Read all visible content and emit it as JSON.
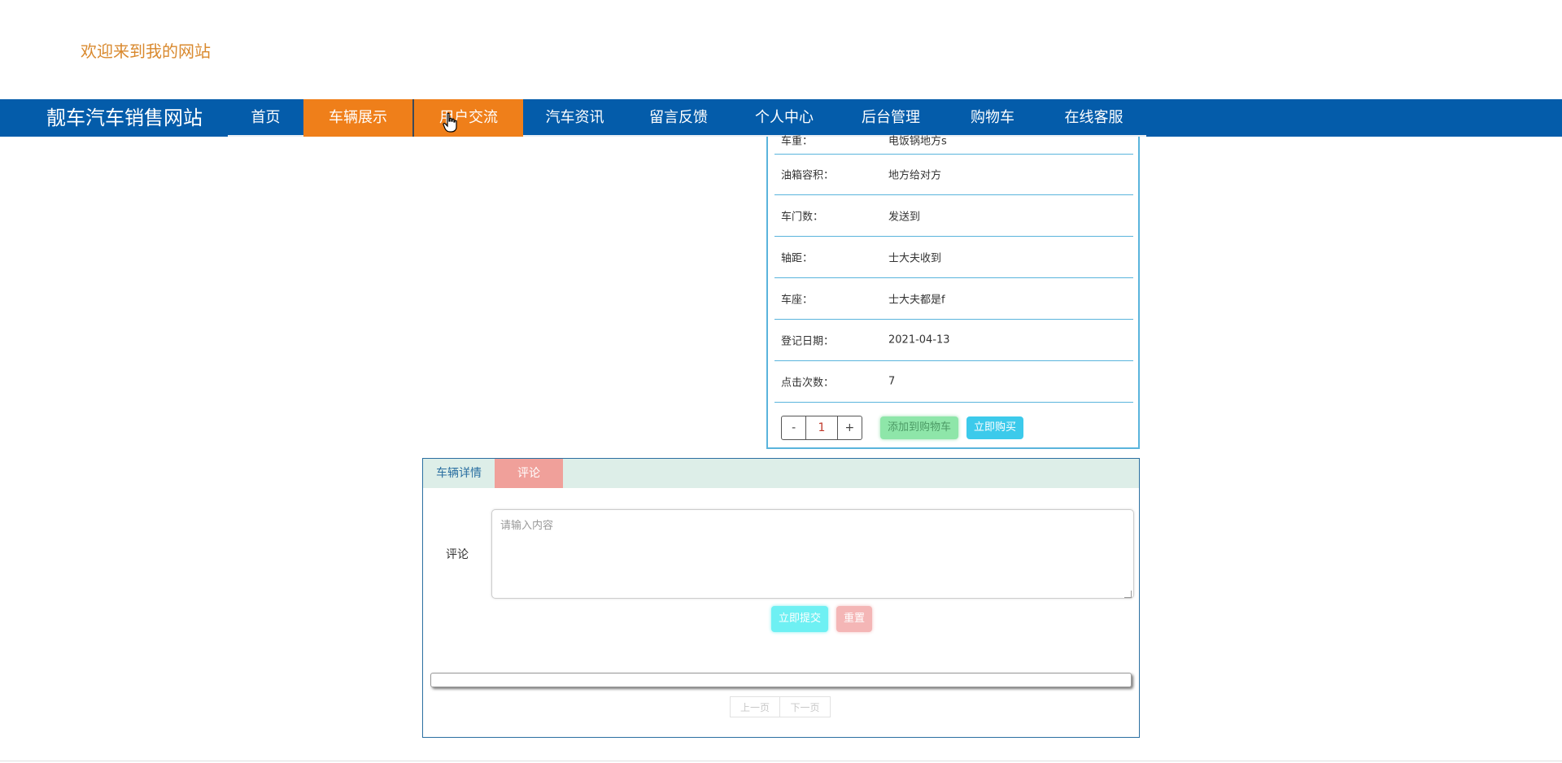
{
  "header": {
    "welcome": "欢迎来到我的网站"
  },
  "navbar": {
    "brand": "靓车汽车销售网站",
    "items": [
      {
        "label": "首页",
        "active": false
      },
      {
        "label": "车辆展示",
        "active": true
      },
      {
        "label": "用户交流",
        "active": true
      },
      {
        "label": "汽车资讯",
        "active": false
      },
      {
        "label": "留言反馈",
        "active": false
      },
      {
        "label": "个人中心",
        "active": false
      },
      {
        "label": "后台管理",
        "active": false
      },
      {
        "label": "购物车",
        "active": false
      },
      {
        "label": "在线客服",
        "active": false
      }
    ]
  },
  "specs": {
    "rows": [
      {
        "label": "车重：",
        "value": "电饭锅地方s"
      },
      {
        "label": "油箱容积：",
        "value": "地方给对方"
      },
      {
        "label": "车门数：",
        "value": "发送到"
      },
      {
        "label": "轴距：",
        "value": "士大夫收到"
      },
      {
        "label": "车座：",
        "value": "士大夫都是f"
      },
      {
        "label": "登记日期：",
        "value": "2021-04-13"
      },
      {
        "label": "点击次数：",
        "value": "7"
      }
    ],
    "quantity": {
      "minus": "-",
      "value": "1",
      "plus": "+"
    },
    "add_to_cart": "添加到购物车",
    "buy_now": "立即购买"
  },
  "tabs": {
    "detail": "车辆详情",
    "comment": "评论"
  },
  "comment_form": {
    "label": "评论",
    "placeholder": "请输入内容",
    "submit": "立即提交",
    "reset": "重置"
  },
  "pagination": {
    "prev": "上一页",
    "next": "下一页"
  },
  "colors": {
    "nav_bg": "#045caa",
    "nav_active": "#ef7f1a",
    "welcome_text": "#d9892e",
    "spec_border": "#5ab4dc",
    "cart_button": "#8ee6a9",
    "buy_button": "#3ccaeb",
    "comment_tab": "#f0a09a",
    "submit_button": "#6ef0f3",
    "reset_button": "#f4b6b6"
  }
}
